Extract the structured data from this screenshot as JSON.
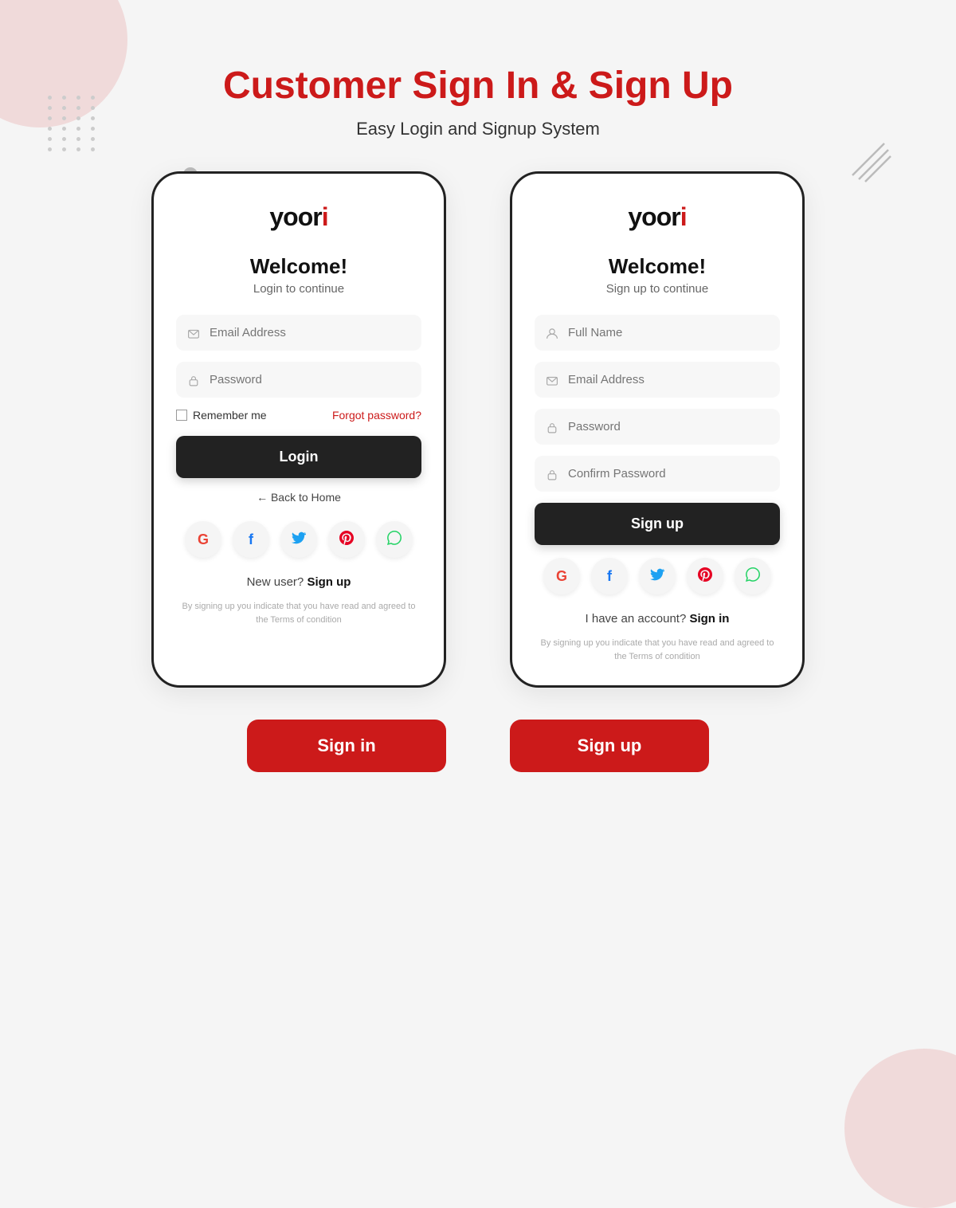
{
  "page": {
    "title": "Customer Sign In & Sign Up",
    "subtitle": "Easy Login and Signup System",
    "background_color": "#f5f5f5"
  },
  "signin_card": {
    "logo": "yoori",
    "logo_dot": "i",
    "welcome_title": "Welcome!",
    "welcome_subtitle": "Login to continue",
    "email_placeholder": "Email Address",
    "password_placeholder": "Password",
    "remember_label": "Remember me",
    "forgot_label": "Forgot password?",
    "main_button": "Login",
    "back_home": "← Back to Home",
    "alt_text": "New user?",
    "alt_link": "Sign up",
    "terms": "By signing up you indicate that you have read and agreed to the Terms of condition"
  },
  "signup_card": {
    "logo": "yoori",
    "logo_dot": "i",
    "welcome_title": "Welcome!",
    "welcome_subtitle": "Sign up to continue",
    "fullname_placeholder": "Full Name",
    "email_placeholder": "Email Address",
    "password_placeholder": "Password",
    "confirm_placeholder": "Confirm Password",
    "main_button": "Sign up",
    "alt_text": "I have an account?",
    "alt_link": "Sign in",
    "terms": "By signing up you indicate that you have read and agreed to the Terms of condition"
  },
  "social": {
    "google": "G",
    "facebook": "f",
    "twitter": "t",
    "pinterest": "p",
    "phone": "c"
  },
  "bottom_buttons": {
    "signin": "Sign in",
    "signup": "Sign up"
  }
}
